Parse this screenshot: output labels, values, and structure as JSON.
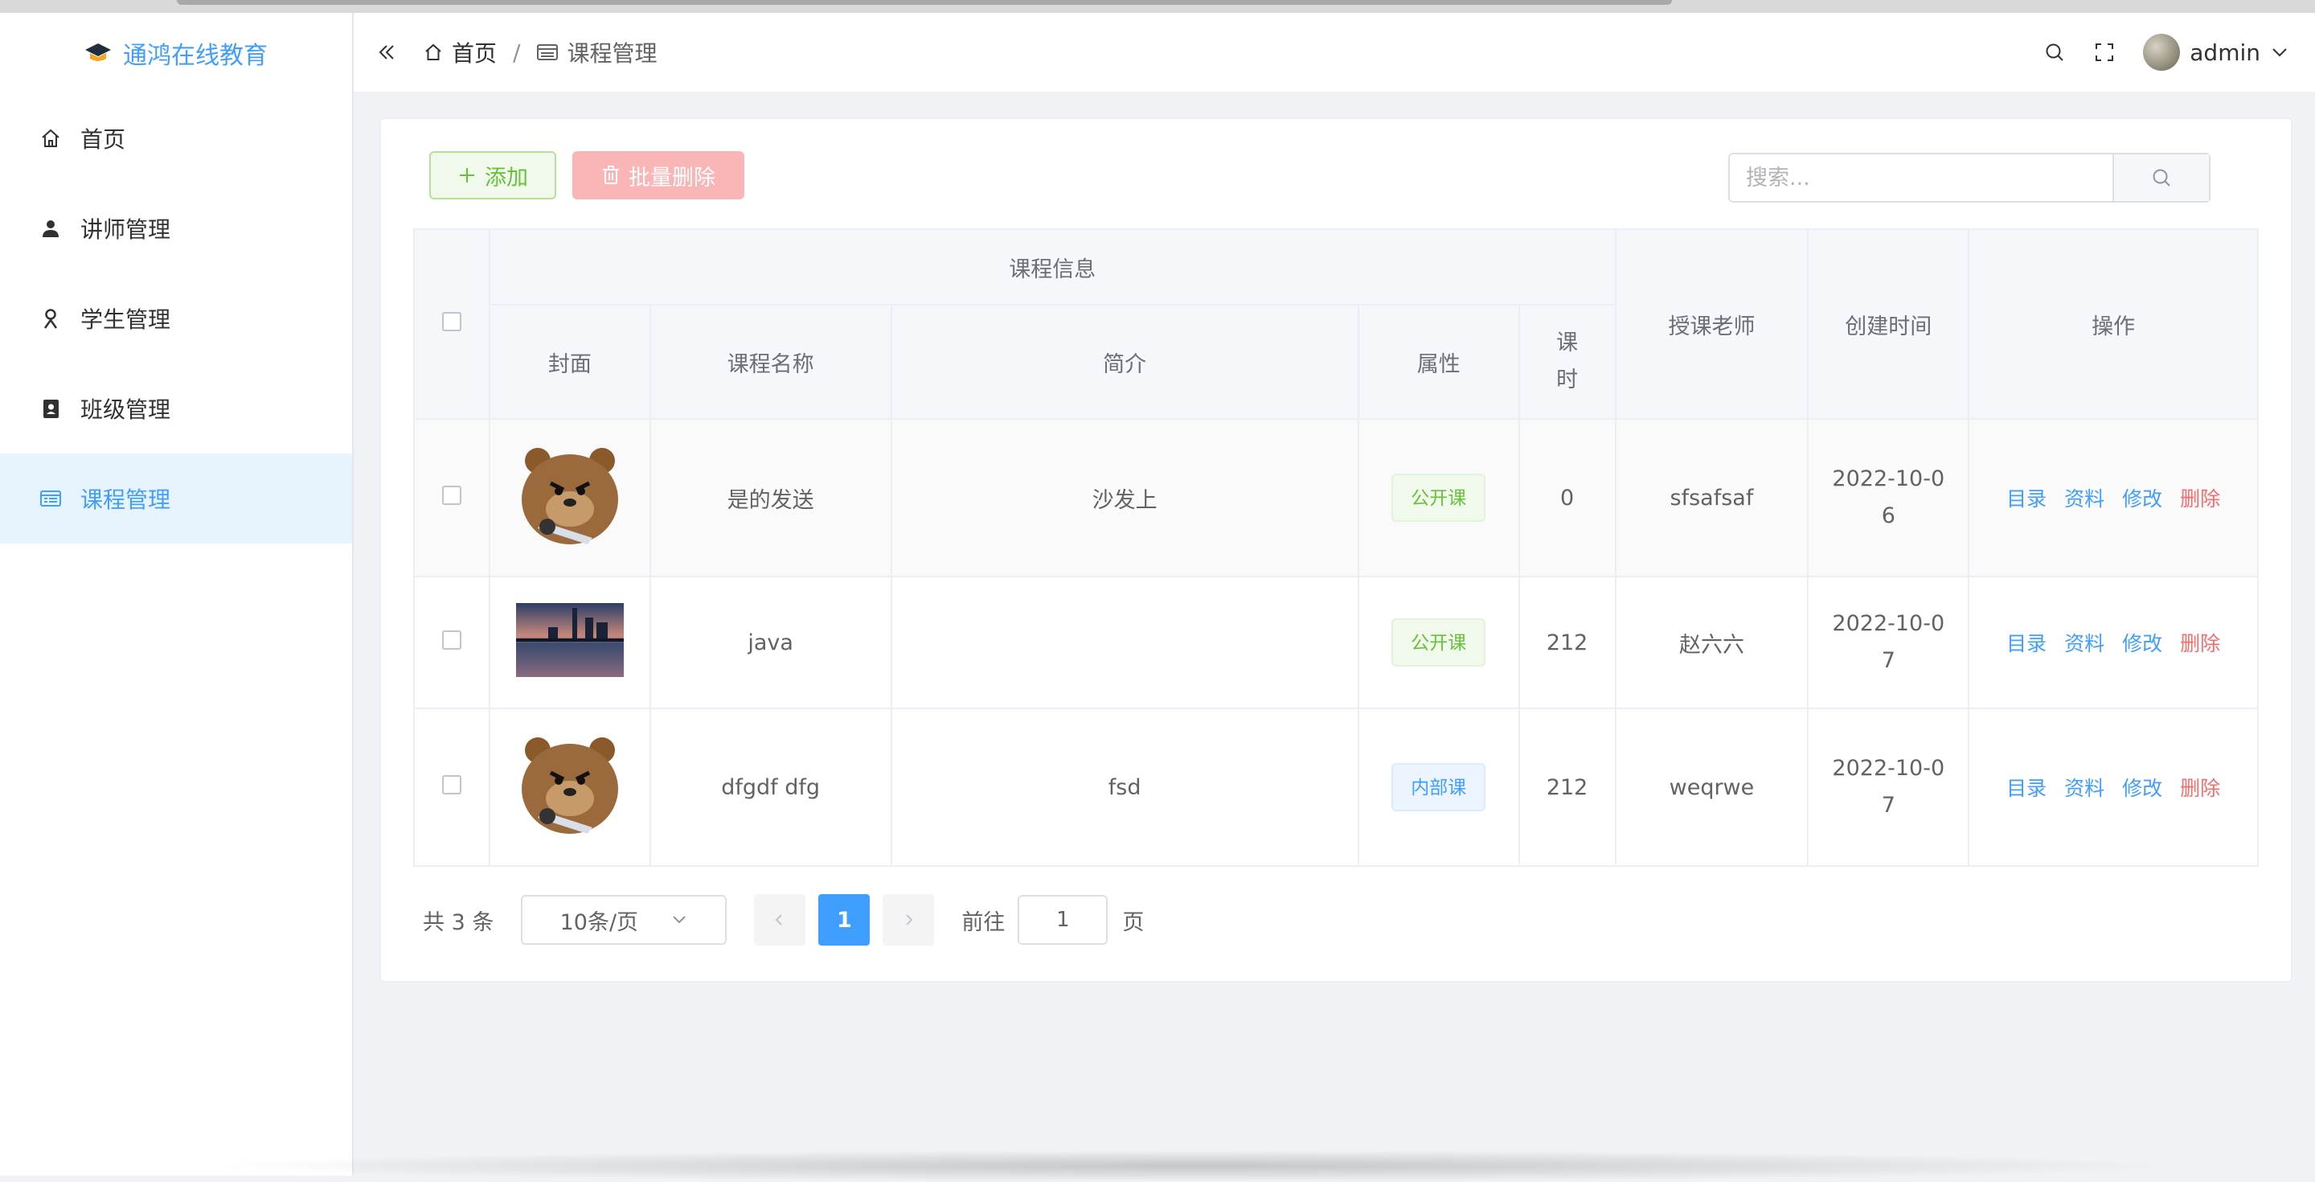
{
  "sidebar": {
    "brand": "通鸿在线教育",
    "items": [
      {
        "label": "首页",
        "icon": "home-icon"
      },
      {
        "label": "讲师管理",
        "icon": "user-icon"
      },
      {
        "label": "学生管理",
        "icon": "student-icon"
      },
      {
        "label": "班级管理",
        "icon": "contacts-icon"
      },
      {
        "label": "课程管理",
        "icon": "list-icon",
        "active": true
      }
    ]
  },
  "header": {
    "breadcrumb": {
      "home": "首页",
      "separator": "/",
      "current": "课程管理"
    },
    "user": "admin"
  },
  "toolbar": {
    "add_label": "添加",
    "batch_delete_label": "批量删除",
    "search_placeholder": "搜索..."
  },
  "table": {
    "group_header": "课程信息",
    "columns": {
      "cover": "封面",
      "name": "课程名称",
      "intro": "简介",
      "attr": "属性",
      "hours": "课时",
      "teacher": "授课老师",
      "created": "创建时间",
      "ops": "操作"
    },
    "hours_header_lines": [
      "课",
      "时"
    ],
    "rows": [
      {
        "cover": "bear",
        "name": "是的发送",
        "intro": "沙发上",
        "attr": "公开课",
        "attr_type": "public",
        "hours": "0",
        "teacher": "sfsafsaf",
        "created_line1": "2022-10-0",
        "created_line2": "6"
      },
      {
        "cover": "cityscape",
        "name": "java",
        "intro": "",
        "attr": "公开课",
        "attr_type": "public",
        "hours": "212",
        "teacher": "赵六六",
        "created_line1": "2022-10-0",
        "created_line2": "7"
      },
      {
        "cover": "bear",
        "name": "dfgdf dfg",
        "intro": "fsd",
        "attr": "内部课",
        "attr_type": "internal",
        "hours": "212",
        "teacher": "weqrwe",
        "created_line1": "2022-10-0",
        "created_line2": "7"
      }
    ],
    "ops": {
      "catalog": "目录",
      "material": "资料",
      "edit": "修改",
      "delete": "删除"
    }
  },
  "pagination": {
    "total_text": "共 3 条",
    "page_size": "10条/页",
    "current_page": "1",
    "goto_label": "前往",
    "goto_value": "1",
    "page_unit": "页"
  },
  "colors": {
    "primary": "#409eff",
    "success": "#67c23a",
    "danger": "#f56c6c",
    "active_bg": "#e8f4fd"
  }
}
